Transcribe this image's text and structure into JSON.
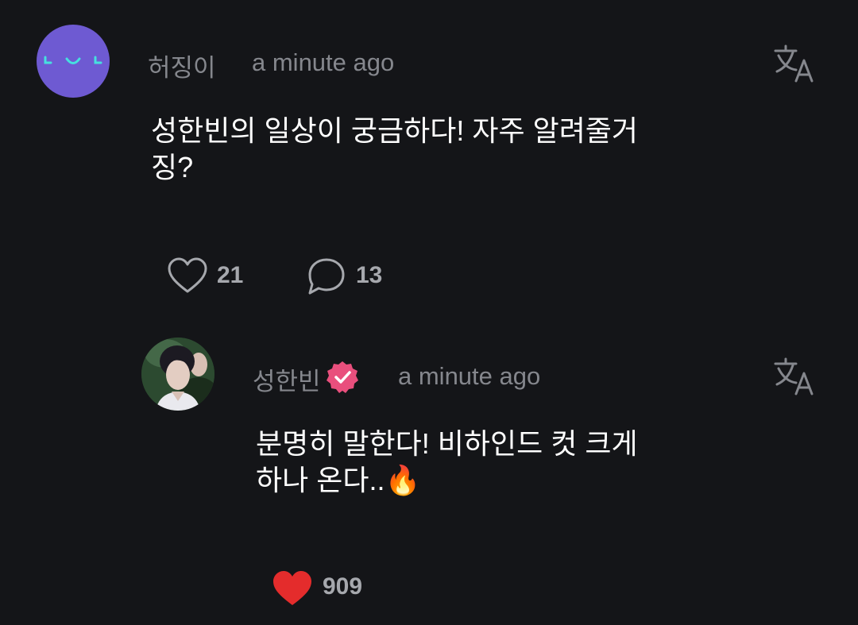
{
  "comment": {
    "username": "허징이",
    "timestamp": "a minute ago",
    "text": "성한빈의 일상이 궁금하다! 자주 알려줄거\n징?",
    "like_count": "21",
    "reply_count": "13",
    "avatar_icon": "smile-face-icon",
    "translate_icon": "translate-icon"
  },
  "reply": {
    "username": "성한빈",
    "verified_icon": "verified-badge-icon",
    "timestamp": "a minute ago",
    "text": "분명히 말한다! 비하인드 컷 크게\n하나 온다..🔥",
    "like_count": "909",
    "liked": true,
    "translate_icon": "translate-icon"
  },
  "colors": {
    "background": "#141518",
    "muted_text": "#85878d",
    "avatar_purple": "#6e5ad2",
    "avatar_face": "#46e0df",
    "verified_pink": "#e94f7d",
    "heart_red": "#e42c2c"
  }
}
